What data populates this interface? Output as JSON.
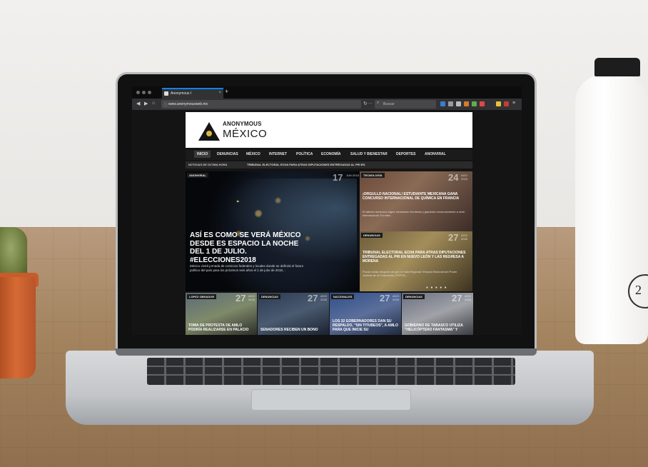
{
  "browser": {
    "tab_title": "Anonymous I",
    "tab_close": "×",
    "new_tab": "+",
    "url": "www.anonymousweb.mx",
    "url_menu": "···",
    "search_placeholder": "Buscar"
  },
  "site": {
    "logo_top": "ANONYMOUS",
    "logo_bottom": "MÉXICO",
    "menu": [
      "INICIO",
      "DENUNCIAS",
      "MÉXICO",
      "INTERNET",
      "POLÍTICA",
      "ECONOMÍA",
      "SALUD Y BIENESTAR",
      "DEPORTES",
      "ANONVIRAL"
    ],
    "ticker_label": "NOTICIAS DE ÚLTIMA HORA",
    "ticker_text": "TRIBUNAL ELECTORAL ECHA PARA ATRAS DIPUTACIONES ENTREGADAS AL PRI EN"
  },
  "hero": {
    "tag": "ANONVIRAL",
    "day": "17",
    "month": "JUN 2018",
    "title": "ASÍ ES COMO SE VERÁ MÉXICO DESDE ES ESPACIO LA NOCHE DEL 1 DE JULIO. #ELECCIONES2018",
    "excerpt": "México vivirá jornada de comicios federales y locales donde se definirá el futuro político del país para los próximos seis años el 1 de julio de 2018..."
  },
  "side": [
    {
      "tag": "TECNOLOGÍA",
      "day": "24",
      "month": "AGO 2018",
      "title": "¡ORGULLO NACIONAL! ESTUDIANTE MEXICANA GANA CONCURSO INTERNACIONAL DE QUÍMICA EN FRANCIA",
      "excerpt": "El talento mexicano sigue rebasando fronteras y ganando reconocimiento a nivel internacional. En esta..."
    },
    {
      "tag": "DENUNCIAS",
      "day": "27",
      "month": "AGO 2018",
      "title": "TRIBUNAL ELECTORAL ECHA PARA ATRAS DIPUTACIONES ENTREGADAS AL PRI EN NUEVO LEÓN Y LAS REGRESA A MORENA",
      "excerpt": "Pocas horas después de que la Sala Regional Tribunal Electoral del Poder Judicial de la Federación (TEPJF)..."
    }
  ],
  "slider_dots": "● ● ● ● ●",
  "small_cards": [
    {
      "tag": "LOPEZ OBRADOR",
      "day": "27",
      "month": "AGO 2018",
      "title": "TOMA DE PROTESTA DE AMLO PODRÍA REALIZARSE EN PALACIO"
    },
    {
      "tag": "DENUNCIAS",
      "day": "27",
      "month": "AGO 2018",
      "title": "SENADORES RECIBEN UN BONO"
    },
    {
      "tag": "NACIONALES",
      "day": "27",
      "month": "AGO 2018",
      "title": "LOS 32 GOBERNADORES DAN SU RESPALDO, \"SIN TITUBEOS\", A AMLO PARA QUE INICIE SU"
    },
    {
      "tag": "DENUNCIAS",
      "day": "27",
      "month": "AGO 2018",
      "title": "GOBIERNO DE TABASCO UTILIZA \"HELICÓPTERO FANTASMA\" Y"
    }
  ],
  "bottle_badge": "2"
}
